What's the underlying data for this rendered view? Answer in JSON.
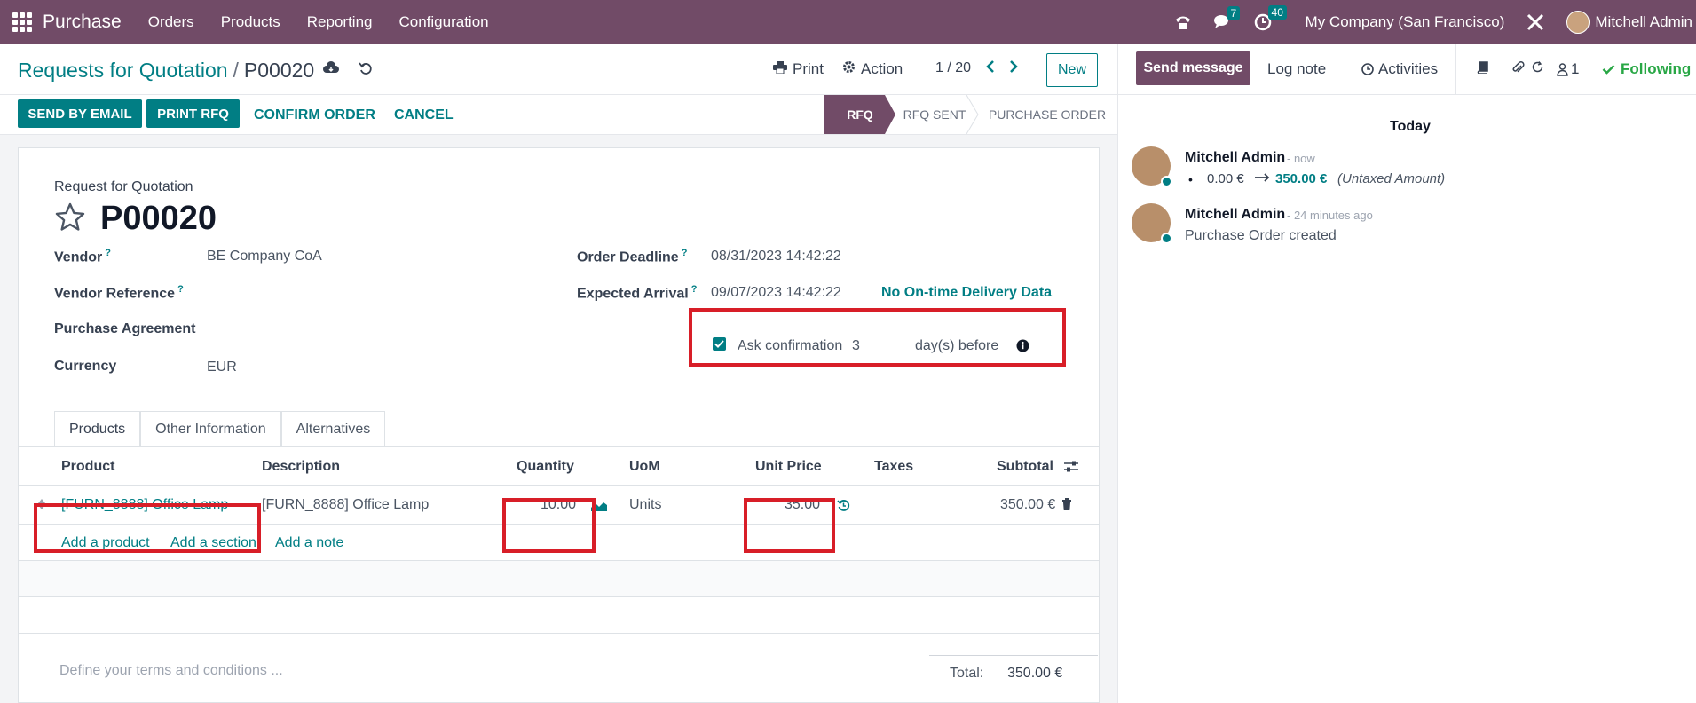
{
  "topbar": {
    "app_name": "Purchase",
    "menus": [
      "Orders",
      "Products",
      "Reporting",
      "Configuration"
    ],
    "chat_badge": "7",
    "activity_badge": "40",
    "company": "My Company (San Francisco)",
    "user": "Mitchell Admin"
  },
  "breadcrumb": {
    "parent": "Requests for Quotation",
    "separator": "/",
    "current": "P00020"
  },
  "controls": {
    "print": "Print",
    "action": "Action",
    "pager": "1 / 20",
    "new": "New"
  },
  "actions": {
    "send_by_email": "SEND BY EMAIL",
    "print_rfq": "PRINT RFQ",
    "confirm_order": "CONFIRM ORDER",
    "cancel": "CANCEL"
  },
  "stages": [
    "RFQ",
    "RFQ SENT",
    "PURCHASE ORDER"
  ],
  "form": {
    "subtitle": "Request for Quotation",
    "title": "P00020",
    "vendor_label": "Vendor",
    "vendor_value": "BE Company CoA",
    "vendor_ref_label": "Vendor Reference",
    "agreement_label": "Purchase Agreement",
    "currency_label": "Currency",
    "currency_value": "EUR",
    "deadline_label": "Order Deadline",
    "deadline_value": "08/31/2023 14:42:22",
    "arrival_label": "Expected Arrival",
    "arrival_value": "09/07/2023 14:42:22",
    "ontime_link": "No On-time Delivery Data",
    "ask_confirmation_label": "Ask confirmation",
    "ask_confirmation_days": "3",
    "days_before": "day(s) before",
    "ask_confirmation_checked": true
  },
  "tabs": [
    "Products",
    "Other Information",
    "Alternatives"
  ],
  "table": {
    "headers": {
      "product": "Product",
      "description": "Description",
      "quantity": "Quantity",
      "uom": "UoM",
      "unit_price": "Unit Price",
      "taxes": "Taxes",
      "subtotal": "Subtotal"
    },
    "row": {
      "product": "[FURN_8888] Office Lamp",
      "description": "[FURN_8888] Office Lamp",
      "quantity": "10.00",
      "uom": "Units",
      "unit_price": "35.00",
      "subtotal": "350.00 €"
    },
    "add_product": "Add a product",
    "add_section": "Add a section",
    "add_note": "Add a note"
  },
  "footer": {
    "terms_placeholder": "Define your terms and conditions ...",
    "total_label": "Total:",
    "total_value": "350.00 €"
  },
  "chatter": {
    "send_message": "Send message",
    "log_note": "Log note",
    "activities": "Activities",
    "followers_count": "1",
    "following": "Following",
    "date_separator": "Today",
    "messages": [
      {
        "author": "Mitchell Admin",
        "time": "- now",
        "old_value": "0.00 €",
        "new_value": "350.00 €",
        "field": "(Untaxed Amount)"
      },
      {
        "author": "Mitchell Admin",
        "time": "- 24 minutes ago",
        "body": "Purchase Order created"
      }
    ]
  },
  "colors": {
    "brand": "#714B67",
    "accent": "#017E84",
    "highlight": "#d81e28"
  }
}
